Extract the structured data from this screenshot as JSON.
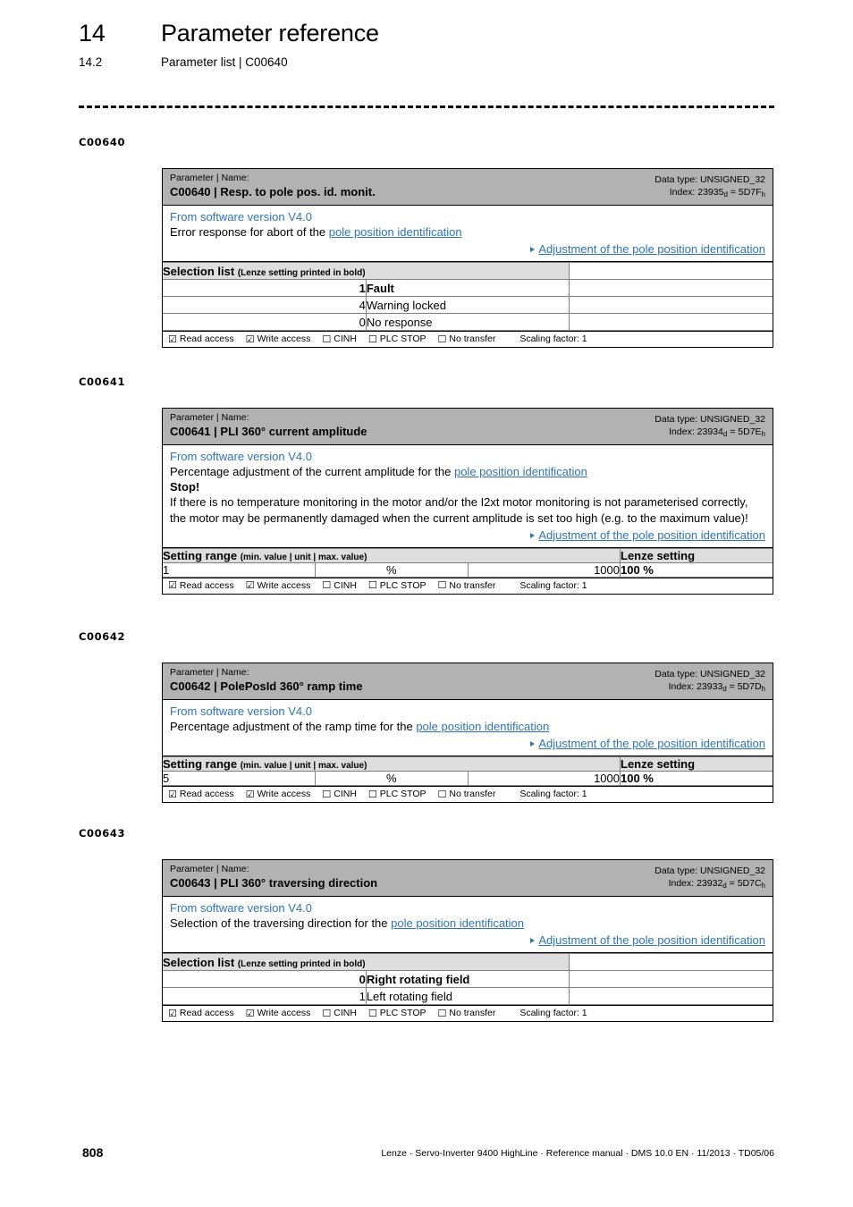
{
  "header": {
    "chapter_number": "14",
    "chapter_title": "Parameter reference",
    "section_number": "14.2",
    "section_title": "Parameter list | C00640"
  },
  "colors": {
    "link_blue": "#2e74b5",
    "head_bar_gray": "#b2b2b2",
    "table_head_gray": "#dedede"
  },
  "common": {
    "kicker": "Parameter | Name:",
    "data_type_label": "Data type: UNSIGNED_32",
    "index_prefix": "Index: ",
    "sw_version": "From software version V4.0",
    "xref_label": "Adjustment of the pole position identification",
    "pole_link_text": "pole position identification",
    "selection_list_title": "Selection list",
    "selection_list_note": "(Lenze setting printed in bold)",
    "setting_range_title": "Setting range",
    "setting_range_note": "(min. value | unit | max. value)",
    "lenze_setting_title": "Lenze setting",
    "access": {
      "checked_glyph": "☑",
      "unchecked_glyph": "☐",
      "read_access": "Read access",
      "write_access": "Write access",
      "cinh": "CINH",
      "plc_stop": "PLC STOP",
      "no_transfer": "No transfer",
      "scaling_factor": "Scaling factor: 1"
    }
  },
  "blocks": [
    {
      "margin_label": "C00640",
      "title": "C00640 | Resp. to pole pos. id. monit.",
      "index_dec": "23935",
      "index_hex": "5D7F",
      "desc_pre": "Error response for abort of the ",
      "desc_post": "",
      "table_type": "selection",
      "rows": [
        {
          "code": "1",
          "text": "Fault",
          "bold": true
        },
        {
          "code": "4",
          "text": "Warning locked",
          "bold": false
        },
        {
          "code": "0",
          "text": "No response",
          "bold": false
        }
      ]
    },
    {
      "margin_label": "C00641",
      "title": "C00641 | PLI 360° current amplitude",
      "index_dec": "23934",
      "index_hex": "5D7E",
      "desc_pre": "Percentage adjustment of the current amplitude for the ",
      "desc_post": "",
      "warning_title": "Stop!",
      "warning_text": "If there is no temperature monitoring in the motor and/or the I2xt motor monitoring is not parameterised correctly, the motor may be permanently damaged when the current amplitude is set too high (e.g. to the maximum value)!",
      "table_type": "range",
      "range": {
        "min": "1",
        "unit": "%",
        "max": "1000",
        "lenze": "100 %"
      }
    },
    {
      "margin_label": "C00642",
      "title": "C00642 | PolePosId 360° ramp time",
      "index_dec": "23933",
      "index_hex": "5D7D",
      "desc_pre": "Percentage adjustment of the ramp time for the ",
      "desc_post": "",
      "table_type": "range",
      "range": {
        "min": "5",
        "unit": "%",
        "max": "1000",
        "lenze": "100 %"
      }
    },
    {
      "margin_label": "C00643",
      "title": "C00643 | PLI 360° traversing direction",
      "index_dec": "23932",
      "index_hex": "5D7C",
      "desc_pre": "Selection of the traversing direction for the ",
      "desc_post": "",
      "table_type": "selection",
      "rows": [
        {
          "code": "0",
          "text": "Right rotating field",
          "bold": true
        },
        {
          "code": "1",
          "text": "Left rotating field",
          "bold": false
        }
      ]
    }
  ],
  "footer": {
    "page_number": "808",
    "imprint": "Lenze · Servo-Inverter 9400 HighLine · Reference manual · DMS 10.0 EN · 11/2013 · TD05/06"
  }
}
